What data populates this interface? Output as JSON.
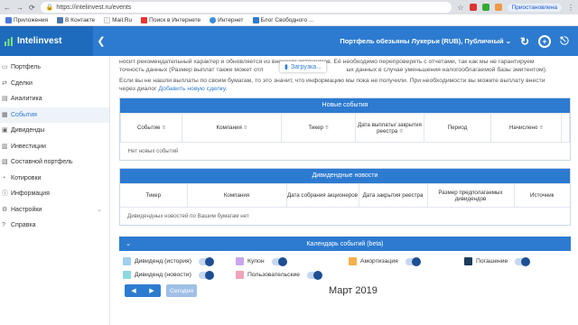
{
  "browser": {
    "url": "https://intelinvest.ru/events",
    "paused_label": "Приостановлена",
    "bookmarks": [
      "Приложения",
      "В Контакте",
      "Mail.Ru",
      "Поиск в Интернете",
      "Интернет",
      "Блог Свободного ..."
    ]
  },
  "header": {
    "logo": "Intelinvest",
    "portfolio": "Портфель обезьяны Лукерьи (RUB), Публичный"
  },
  "sidebar": {
    "items": [
      {
        "label": "Портфель",
        "icon": "briefcase-icon"
      },
      {
        "label": "Сделки",
        "icon": "trades-icon"
      },
      {
        "label": "Аналитика",
        "icon": "analytics-icon"
      },
      {
        "label": "События",
        "icon": "events-icon",
        "active": true
      },
      {
        "label": "Дивиденды",
        "icon": "dividends-icon"
      },
      {
        "label": "Инвестиции",
        "icon": "investments-icon"
      },
      {
        "label": "Составной портфель",
        "icon": "composite-icon"
      },
      {
        "label": "Котировки",
        "icon": "quotes-icon"
      },
      {
        "label": "Информация",
        "icon": "info-icon"
      },
      {
        "label": "Настройки",
        "icon": "settings-icon"
      },
      {
        "label": "Справка",
        "icon": "help-icon"
      }
    ]
  },
  "notice": {
    "line1": "носит рекомендательный характер и обновляется из внешних источников. Её необходимо перепроверять с отчетами, так как мы не гарантируем",
    "line2": "точность данных (Размер выплат также может отл",
    "line2b": "ых данных в случае уменьшения налогооблагаемой базы эмитентом).",
    "line3": "Если вы не нашли выплаты по своим бумагам, то это значит, что информацию мы пока не получили. При необходимости вы можете выплату внести",
    "line4": "через диалог",
    "link": "Добавить новую сделку."
  },
  "loading": "Загрузка...",
  "new_events": {
    "title": "Новые события",
    "columns": [
      "Событие",
      "Компания",
      "Тикер",
      "Дата выплаты/ закрытия реестра",
      "Период",
      "Начислено"
    ],
    "empty": "Нет новых событий"
  },
  "dividend_news": {
    "title": "Дивидендные новости",
    "columns": [
      "Тикер",
      "Компания",
      "Дата собрания акционеров",
      "Дата закрытия реестра",
      "Размер предполагаемых дивидендов",
      "Источник"
    ],
    "empty": "Дивидендных новостей по Вашим бумагам нет"
  },
  "calendar": {
    "title": "Календарь событий (beta)",
    "legend": [
      {
        "label": "Дивиденд (история)",
        "color": "#9fd0f0"
      },
      {
        "label": "Купон",
        "color": "#c9a6f0"
      },
      {
        "label": "Амортизация",
        "color": "#f6b04a"
      },
      {
        "label": "Погашение",
        "color": "#1d3c5c"
      },
      {
        "label": "Дивиденд (новости)",
        "color": "#8ed8e0"
      },
      {
        "label": "Пользовательские",
        "color": "#f3a3b8"
      }
    ],
    "today": "Сегодня",
    "month": "Март 2019"
  }
}
